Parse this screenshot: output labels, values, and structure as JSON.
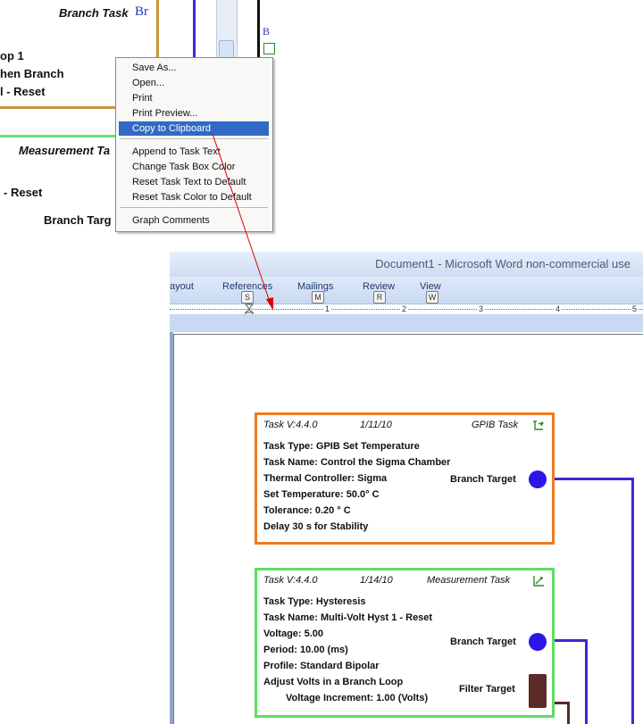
{
  "background_app": {
    "branch_task": {
      "title": "Branch Task",
      "icon_text": "Br"
    },
    "side_letter": "B",
    "fragments": [
      "op 1",
      "hen Branch",
      "l - Reset",
      "- Reset",
      "Branch Targ"
    ],
    "measurement_task": {
      "title": "Measurement Ta"
    }
  },
  "context_menu": {
    "items": [
      {
        "label": "Save As..."
      },
      {
        "label": "Open..."
      },
      {
        "label": "Print"
      },
      {
        "label": "Print Preview..."
      },
      {
        "label": "Copy to Clipboard",
        "selected": true
      },
      {
        "label": "Append to Task Text"
      },
      {
        "label": "Change Task Box Color"
      },
      {
        "label": "Reset Task Text to Default"
      },
      {
        "label": "Reset Task Color to Default"
      },
      {
        "label": "Graph Comments"
      }
    ]
  },
  "word": {
    "title": "Document1 - Microsoft Word non-commercial use",
    "tabs": [
      {
        "label": "ayout",
        "keytip": ""
      },
      {
        "label": "References",
        "keytip": "S"
      },
      {
        "label": "Mailings",
        "keytip": "M"
      },
      {
        "label": "Review",
        "keytip": "R"
      },
      {
        "label": "View",
        "keytip": "W"
      }
    ],
    "ruler_numbers": [
      "1",
      "2",
      "3",
      "4",
      "5"
    ]
  },
  "tasks": [
    {
      "version": "Task V:4.4.0",
      "date": "1/11/10",
      "kind": "GPIB Task",
      "icon": "gpib-icon",
      "color": "#f07a1e",
      "lines": [
        "Task Type: GPIB Set Temperature",
        "Task Name: Control the Sigma Chamber",
        "Thermal Controller: Sigma",
        "Set Temperature: 50.0° C",
        "Tolerance: 0.20 ° C",
        "Delay 30 s for Stability"
      ],
      "branch_target": "Branch Target"
    },
    {
      "version": "Task V:4.4.0",
      "date": "1/14/10",
      "kind": "Measurement Task",
      "icon": "measurement-icon",
      "color": "#5fde5f",
      "lines": [
        "Task Type: Hysteresis",
        "Task Name: Multi-Volt Hyst 1 - Reset",
        "Voltage: 5.00",
        "Period: 10.00  (ms)",
        "Profile: Standard Bipolar",
        "Adjust Volts in a Branch Loop",
        "Voltage Increment: 1.00   (Volts)"
      ],
      "branch_target": "Branch Target",
      "filter_target": "Filter Target"
    }
  ],
  "colors": {
    "branch_line": "#3a2bd4",
    "arrow": "#e00000",
    "selection": "#316ac5",
    "filter_target": "#5a2a26"
  }
}
